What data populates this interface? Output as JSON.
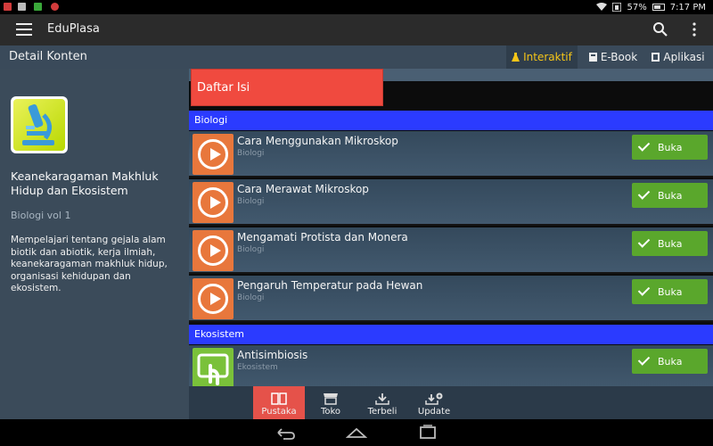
{
  "status_bar": {
    "battery": "57%",
    "time": "7:17 PM",
    "colors": {
      "notif1": "#d23c3c",
      "notif2": "#3aa83a",
      "notif3": "#d23c3c"
    }
  },
  "app_bar": {
    "title": "EduPlasa",
    "icons": {
      "menu": "hamburger-menu-icon",
      "search": "search-icon",
      "more": "more-vert-icon"
    }
  },
  "detail_header": {
    "title": "Detail Konten",
    "tabs": [
      {
        "label": "Interaktif",
        "icon": "flask-icon",
        "active": true
      },
      {
        "label": "E-Book",
        "icon": "book-icon",
        "active": false
      },
      {
        "label": "Aplikasi",
        "icon": "app-icon",
        "active": false
      }
    ],
    "active_color": "#f5c518"
  },
  "book": {
    "cover_icon": "microscope-icon",
    "title": "Keanekaragaman Makhluk Hidup dan Ekosistem",
    "subtitle": "Biologi vol 1",
    "description": "Mempelajari tentang gejala alam biotik dan abiotik, kerja ilmiah, keanekaragaman makhluk hidup, organisasi kehidupan dan ekosistem."
  },
  "toc": {
    "label": "Daftar Isi",
    "button_label": "Buka",
    "sections": [
      {
        "name": "Biologi",
        "items": [
          {
            "title": "Cara Menggunakan Mikroskop",
            "category": "Biologi",
            "icon": "play-icon"
          },
          {
            "title": "Cara Merawat Mikroskop",
            "category": "Biologi",
            "icon": "play-icon"
          },
          {
            "title": "Mengamati Protista dan Monera",
            "category": "Biologi",
            "icon": "play-icon"
          },
          {
            "title": "Pengaruh Temperatur pada Hewan",
            "category": "Biologi",
            "icon": "play-icon"
          }
        ]
      },
      {
        "name": "Ekosistem",
        "items": [
          {
            "title": "Antisimbiosis",
            "category": "Ekosistem",
            "icon": "touch-icon"
          }
        ]
      }
    ],
    "colors": {
      "header": "#f04a3f",
      "section": "#2b3bff",
      "button": "#5aa72c",
      "thumb_video": "#e8773c",
      "thumb_touch": "#7ac13a"
    }
  },
  "bottom_nav": {
    "items": [
      {
        "label": "Pustaka",
        "icon": "library-icon",
        "active": true
      },
      {
        "label": "Toko",
        "icon": "store-icon",
        "active": false
      },
      {
        "label": "Terbeli",
        "icon": "download-icon",
        "active": false
      },
      {
        "label": "Update",
        "icon": "update-icon",
        "active": false
      }
    ],
    "active_color": "#e5524a"
  },
  "system_nav": {
    "icons": [
      "back-icon",
      "home-icon",
      "recents-icon"
    ]
  }
}
